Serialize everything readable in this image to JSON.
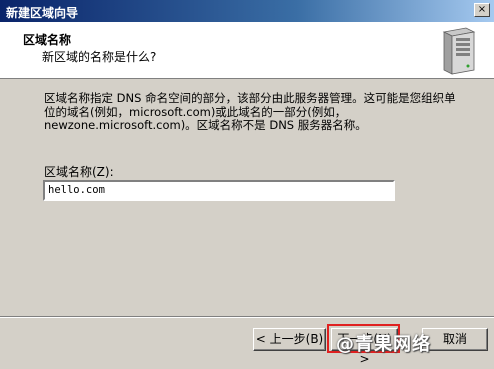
{
  "window": {
    "title": "新建区域向导",
    "close_glyph": "×"
  },
  "header": {
    "title": "区域名称",
    "subtitle": "新区域的名称是什么?",
    "icon": "server-icon"
  },
  "description": "区域名称指定 DNS 命名空间的部分，该部分由此服务器管理。这可能是您组织单位的域名(例如，microsoft.com)或此域名的一部分(例如，newzone.microsoft.com)。区域名称不是 DNS 服务器名称。",
  "zone_name_field": {
    "label": "区域名称(Z):",
    "value": "hello.com"
  },
  "buttons": {
    "back": "< 上一步(B)",
    "next": "下一步(N) >",
    "cancel": "取消"
  },
  "watermark": "@青果网络",
  "colors": {
    "highlight": "#e02020",
    "titlebar": "#0a246a"
  }
}
